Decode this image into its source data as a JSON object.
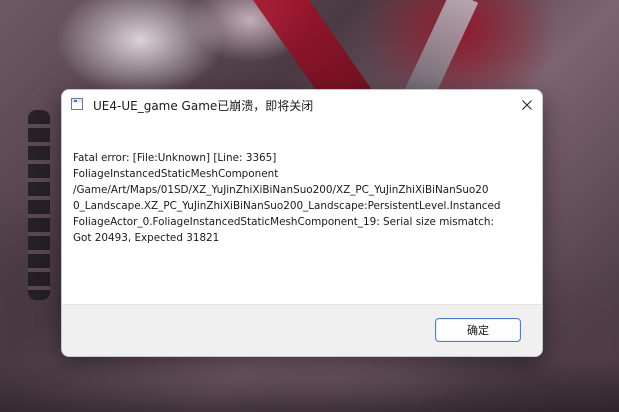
{
  "dialog": {
    "title": "UE4-UE_game Game已崩溃，即将关闭",
    "message_lines": [
      "Fatal error: [File:Unknown] [Line: 3365]",
      "FoliageInstancedStaticMeshComponent",
      "/Game/Art/Maps/01SD/XZ_YuJinZhiXiBiNanSuo200/XZ_PC_YuJinZhiXiBiNanSuo20",
      "0_Landscape.XZ_PC_YuJinZhiXiBiNanSuo200_Landscape:PersistentLevel.Instanced",
      "FoliageActor_0.FoliageInstancedStaticMeshComponent_19: Serial size mismatch:",
      "Got 20493, Expected 31821"
    ],
    "ok_label": "确定",
    "icons": {
      "app": "app-window-icon",
      "close": "close-icon"
    }
  },
  "colors": {
    "ok_border": "#4a7ed0",
    "footer_bg": "#f0f0f0"
  }
}
